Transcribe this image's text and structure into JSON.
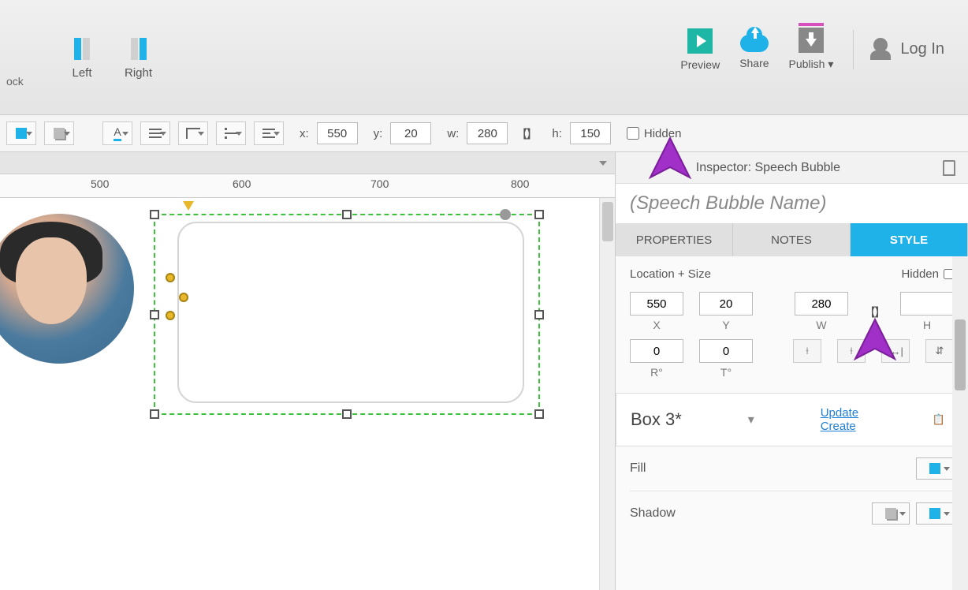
{
  "topToolbar": {
    "lockStub": "ock",
    "alignLeft": "Left",
    "alignRight": "Right",
    "preview": "Preview",
    "share": "Share",
    "publish": "Publish ▾",
    "login": "Log In"
  },
  "secondToolbar": {
    "xLabel": "x:",
    "yLabel": "y:",
    "wLabel": "w:",
    "hLabel": "h:",
    "x": "550",
    "y": "20",
    "w": "280",
    "h": "150",
    "hiddenLabel": "Hidden"
  },
  "ruler": {
    "t500": "500",
    "t600": "600",
    "t700": "700",
    "t800": "800"
  },
  "inspector": {
    "headerLabel": "Inspector: Speech Bubble",
    "nameField": "(Speech Bubble Name)",
    "tabs": {
      "properties": "PROPERTIES",
      "notes": "NOTES",
      "style": "STYLE"
    },
    "style": {
      "locationSizeLabel": "Location + Size",
      "hiddenLabel": "Hidden",
      "x": "550",
      "xLabel": "X",
      "y": "20",
      "yLabel": "Y",
      "w": "280",
      "wLabel": "W",
      "h": "",
      "hLabel": "H",
      "r": "0",
      "rLabel": "R°",
      "t": "0",
      "tLabel": "T°",
      "boxName": "Box 3*",
      "updateLink": "Update",
      "createLink": "Create",
      "fillLabel": "Fill",
      "shadowLabel": "Shadow"
    }
  }
}
